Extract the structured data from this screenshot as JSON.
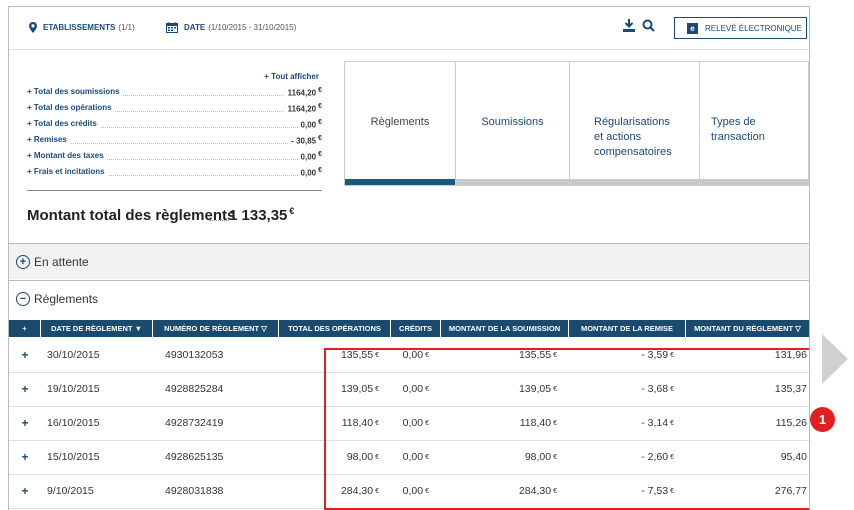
{
  "topbar": {
    "establishments_label": "ETABLISSEMENTS",
    "establishments_count": "(1/1)",
    "date_label": "DATE",
    "date_range": "(1/10/2015 - 31/10/2015)",
    "releve_label": "RELEVÉ ÉLECTRONIQUE",
    "releve_icon": "e"
  },
  "summary": {
    "show_all": "+ Tout afficher",
    "rows": [
      {
        "label": "+ Total des soumissions",
        "value": "1164,20",
        "unit": "€"
      },
      {
        "label": "+ Total des opérations",
        "value": "1164,20",
        "unit": "€"
      },
      {
        "label": "+ Total des crédits",
        "value": "0,00",
        "unit": "€"
      },
      {
        "label": "+ Remises",
        "value": "- 30,85",
        "unit": "€"
      },
      {
        "label": "+ Montant des taxes",
        "value": "0,00",
        "unit": "€"
      },
      {
        "label": "+ Frais et incitations",
        "value": "0,00",
        "unit": "€"
      }
    ],
    "total_label": "Montant total des règlements",
    "total_value": "1 133,35",
    "total_unit": "€"
  },
  "tabs": [
    {
      "line1": "Règlements",
      "line2": "",
      "line3": ""
    },
    {
      "line1": "Soumissions",
      "line2": "",
      "line3": ""
    },
    {
      "line1": "Régularisations",
      "line2": "et actions",
      "line3": "compensatoires"
    },
    {
      "line1": "Types de",
      "line2": "transaction",
      "line3": ""
    }
  ],
  "accordions": {
    "pending": {
      "symbol": "+",
      "label": "En attente"
    },
    "settlements": {
      "symbol": "−",
      "label": "Règlements"
    }
  },
  "table": {
    "headers": [
      "+",
      "DATE DE RÈGLEMENT ▼",
      "NUMÉRO DE RÈGLEMENT ▽",
      "TOTAL DES OPÉRATIONS",
      "CRÉDITS",
      "MONTANT DE LA SOUMISSION",
      "MONTANT DE LA REMISE",
      "MONTANT DU RÈGLEMENT ▽"
    ],
    "rows": [
      {
        "date": "30/10/2015",
        "number": "4930132053",
        "ops": "135,55",
        "credits": "0,00",
        "submission": "135,55",
        "discount": "- 3,59",
        "settlement": "131,96"
      },
      {
        "date": "19/10/2015",
        "number": "4928825284",
        "ops": "139,05",
        "credits": "0,00",
        "submission": "139,05",
        "discount": "- 3,68",
        "settlement": "135,37"
      },
      {
        "date": "16/10/2015",
        "number": "4928732419",
        "ops": "118,40",
        "credits": "0,00",
        "submission": "118,40",
        "discount": "- 3,14",
        "settlement": "115,26"
      },
      {
        "date": "15/10/2015",
        "number": "4928625135",
        "ops": "98,00",
        "credits": "0,00",
        "submission": "98,00",
        "discount": "- 2,60",
        "settlement": "95,40"
      },
      {
        "date": "9/10/2015",
        "number": "4928031838",
        "ops": "284,30",
        "credits": "0,00",
        "submission": "284,30",
        "discount": "- 7,53",
        "settlement": "276,77"
      }
    ],
    "currency": "€",
    "expand_symbol": "+"
  },
  "callout_number": "1",
  "colors": {
    "brand": "#1a4a7a",
    "header_bg": "#1a4a6e",
    "highlight": "#e02020",
    "active_tab": "#1a5a7e"
  }
}
